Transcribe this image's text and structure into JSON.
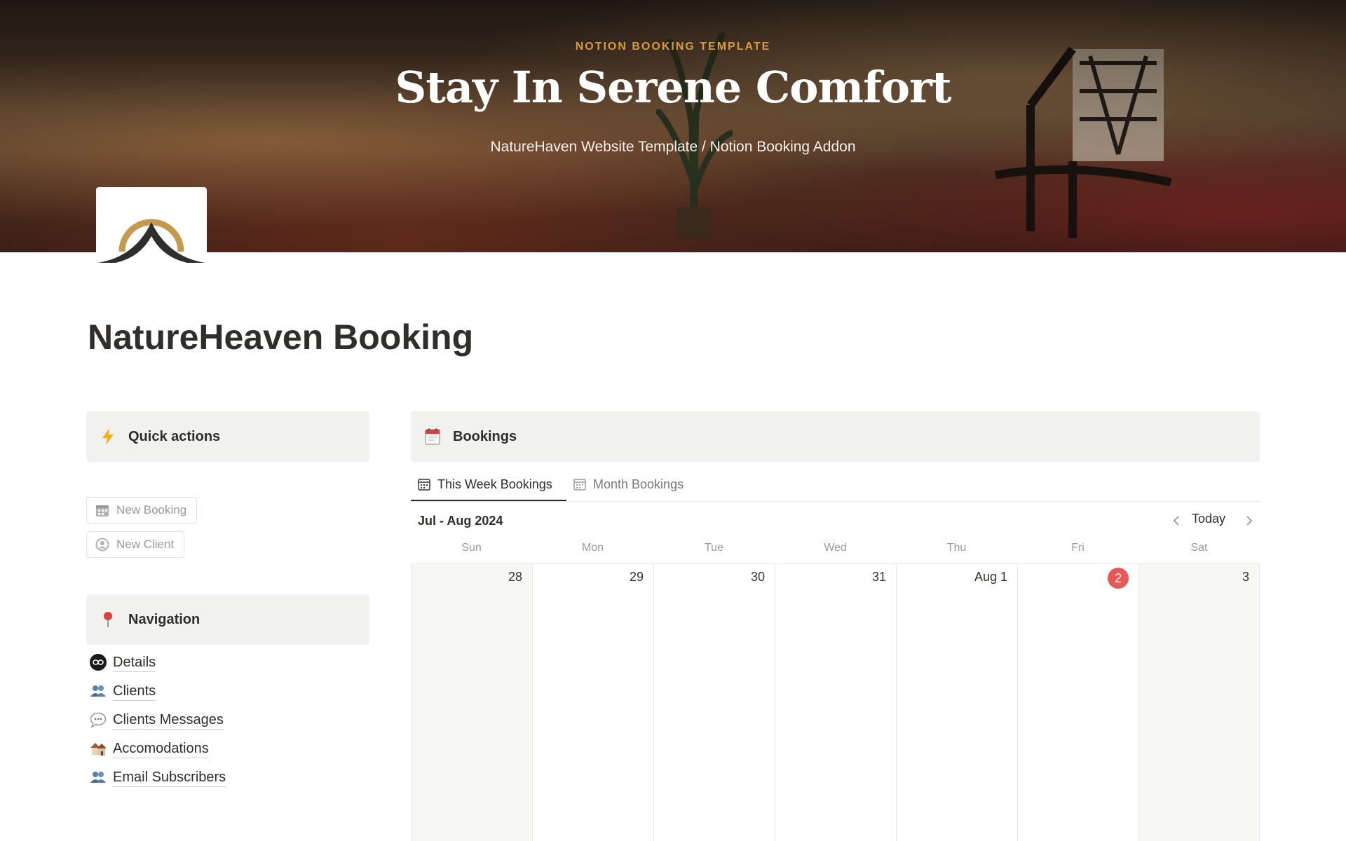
{
  "cover": {
    "kicker": "NOTION BOOKING TEMPLATE",
    "title": "Stay In Serene Comfort",
    "subtitle": "NatureHaven Website Template / Notion Booking Addon"
  },
  "page": {
    "title": "NatureHeaven Booking"
  },
  "quick_actions": {
    "header": "Quick actions",
    "header_icon": "lightning-icon",
    "buttons": [
      {
        "label": "New Booking",
        "icon": "calendar-grid-icon"
      },
      {
        "label": "New Client",
        "icon": "user-circle-icon"
      }
    ]
  },
  "navigation": {
    "header": "Navigation",
    "header_icon": "pin-icon",
    "items": [
      {
        "label": "Details",
        "icon": "link-badge-icon"
      },
      {
        "label": "Clients",
        "icon": "people-icon"
      },
      {
        "label": "Clients Messages",
        "icon": "speech-bubble-icon"
      },
      {
        "label": "Accomodations",
        "icon": "houses-icon"
      },
      {
        "label": "Email Subscribers",
        "icon": "people-icon"
      }
    ]
  },
  "bookings": {
    "header": "Bookings",
    "header_icon": "calendar-tear-off-icon",
    "tabs": [
      {
        "label": "This Week Bookings",
        "active": true
      },
      {
        "label": "Month Bookings",
        "active": false
      }
    ],
    "range_label": "Jul - Aug 2024",
    "today_label": "Today",
    "weekdays": [
      "Sun",
      "Mon",
      "Tue",
      "Wed",
      "Thu",
      "Fri",
      "Sat"
    ],
    "days": [
      "28",
      "29",
      "30",
      "31",
      "Aug 1",
      "2",
      "3"
    ],
    "today_index": 5
  },
  "colors": {
    "accent_gold": "#d89a3a",
    "today_red": "#eb5757",
    "callout_bg": "#f1f1ef",
    "text": "#37352f"
  }
}
